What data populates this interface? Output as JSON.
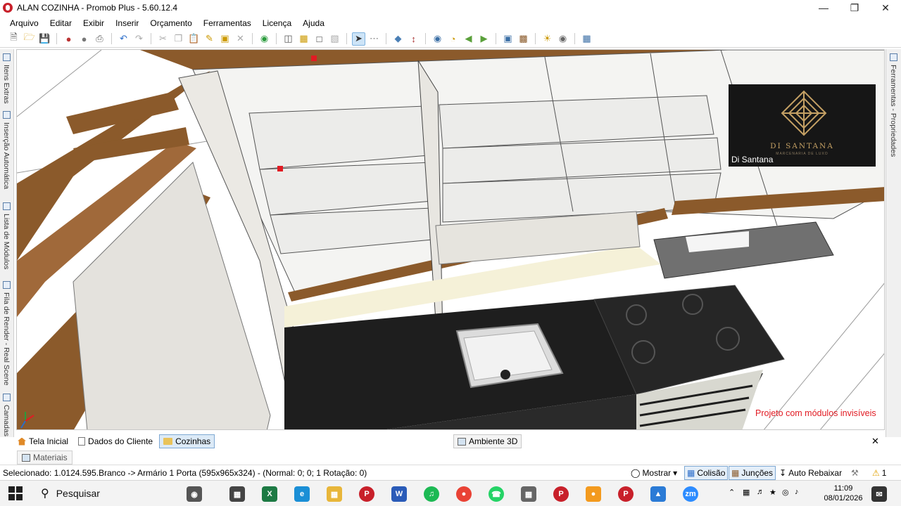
{
  "window": {
    "title": "ALAN COZINHA - Promob Plus - 5.60.12.4"
  },
  "menu": [
    "Arquivo",
    "Editar",
    "Exibir",
    "Inserir",
    "Orçamento",
    "Ferramentas",
    "Licença",
    "Ajuda"
  ],
  "left_dock": [
    "Itens Extras",
    "Inserção Automática",
    "Lista de Módulos",
    "Fila de Render - Real Scene",
    "Camadas"
  ],
  "right_dock": [
    "Ferramentas - Propriedades"
  ],
  "overlay": {
    "brand_name": "DI SANTANA",
    "brand_tagline": "MARCENARIA DE LUXO",
    "caption": "Di Santana"
  },
  "viewport_note": "Projeto com módulos invisíveis",
  "doc_tabs": [
    {
      "label": "Tela Inicial",
      "icon": "home-icon"
    },
    {
      "label": "Dados do Cliente",
      "icon": "document-icon"
    },
    {
      "label": "Cozinhas",
      "icon": "folder-icon",
      "active": true
    }
  ],
  "env_tab": "Ambiente 3D",
  "materials_tab": "Materiais",
  "status": {
    "selected": "Selecionado: 1.0124.595.Branco -> Armário 1 Porta (595x965x324) - (Normal: 0; 0; 1 Rotação: 0)",
    "mostrar": "Mostrar",
    "colisao": "Colisão",
    "juncoes": "Junções",
    "auto_rebaixar": "Auto Rebaixar",
    "warnings": "1"
  },
  "taskbar": {
    "search_placeholder": "Pesquisar",
    "time": "11:09",
    "date": "08/01/2026"
  },
  "colors": {
    "accent_red": "#e11b23",
    "brand_gold": "#c4a064",
    "wood": "#8b5a2b",
    "counter": "#1e1e1e"
  }
}
